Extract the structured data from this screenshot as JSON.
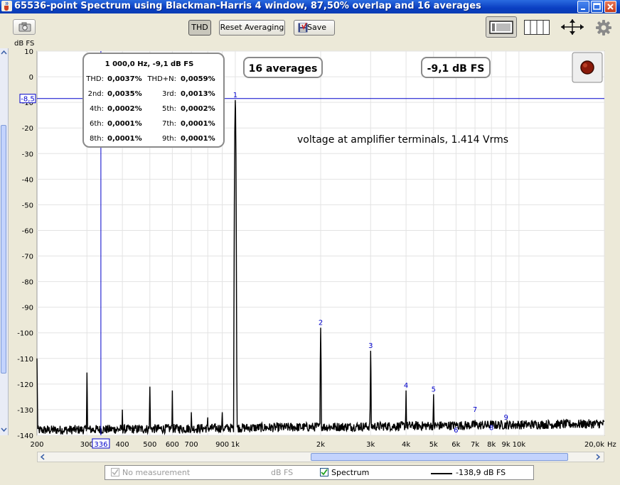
{
  "window": {
    "title": "65536-point Spectrum using Blackman-Harris 4 window, 87,50% overlap and 16 averages"
  },
  "toolbar": {
    "thd_label": "THD",
    "reset_label": "Reset Averaging",
    "save_label": "Save"
  },
  "plot": {
    "y_unit": "dB FS",
    "x_unit": "Hz",
    "background": "#ffffff",
    "grid_color": "#e3e3e3",
    "trace_color": "#000000",
    "cursor_color": "#0000cc",
    "cursor_x_label": "336",
    "cursor_y_label": "-8,5",
    "averages_label": "16 averages",
    "level_label": "-9,1 dB FS",
    "annotation": "voltage at amplifier terminals, 1.414 Vrms",
    "thd_box": {
      "header": "1 000,0 Hz, -9,1 dB FS",
      "rows": [
        {
          "l1": "THD:",
          "v1": "0,0037%",
          "l2": "THD+N:",
          "v2": "0,0059%"
        },
        {
          "l1": "2nd:",
          "v1": "0,0035%",
          "l2": "3rd:",
          "v2": "0,0013%"
        },
        {
          "l1": "4th:",
          "v1": "0,0002%",
          "l2": "5th:",
          "v2": "0,0002%"
        },
        {
          "l1": "6th:",
          "v1": "0,0001%",
          "l2": "7th:",
          "v2": "0,0001%"
        },
        {
          "l1": "8th:",
          "v1": "0,0001%",
          "l2": "9th:",
          "v2": "0,0001%"
        }
      ]
    }
  },
  "chart_data": {
    "type": "line",
    "x_scale": "log",
    "xlim": [
      200,
      20000
    ],
    "ylim": [
      -140,
      10
    ],
    "x_ticks": [
      {
        "v": 200,
        "label": "200"
      },
      {
        "v": 300,
        "label": "300"
      },
      {
        "v": 400,
        "label": "400"
      },
      {
        "v": 500,
        "label": "500"
      },
      {
        "v": 600,
        "label": "600"
      },
      {
        "v": 700,
        "label": "700"
      },
      {
        "v": 900,
        "label": "900"
      },
      {
        "v": 1000,
        "label": "1k"
      },
      {
        "v": 2000,
        "label": "2k"
      },
      {
        "v": 3000,
        "label": "3k"
      },
      {
        "v": 4000,
        "label": "4k"
      },
      {
        "v": 5000,
        "label": "5k"
      },
      {
        "v": 6000,
        "label": "6k"
      },
      {
        "v": 7000,
        "label": "7k"
      },
      {
        "v": 8000,
        "label": "8k"
      },
      {
        "v": 9000,
        "label": "9k"
      },
      {
        "v": 10000,
        "label": "10k"
      },
      {
        "v": 20000,
        "label": "20,0k"
      }
    ],
    "y_ticks": [
      10,
      0,
      -10,
      -20,
      -30,
      -40,
      -50,
      -60,
      -70,
      -80,
      -90,
      -100,
      -110,
      -120,
      -130,
      -140
    ],
    "series": [
      {
        "name": "Spectrum",
        "noise_floor": -138,
        "peaks": [
          {
            "x": 200,
            "y": -110
          },
          {
            "x": 300,
            "y": -115.5
          },
          {
            "x": 400,
            "y": -130
          },
          {
            "x": 500,
            "y": -121
          },
          {
            "x": 600,
            "y": -122.5
          },
          {
            "x": 700,
            "y": -131
          },
          {
            "x": 800,
            "y": -133
          },
          {
            "x": 900,
            "y": -131
          },
          {
            "x": 1000,
            "y": -9.1
          },
          {
            "x": 2000,
            "y": -98
          },
          {
            "x": 3000,
            "y": -107
          },
          {
            "x": 4000,
            "y": -122.5
          },
          {
            "x": 5000,
            "y": -124
          },
          {
            "x": 6000,
            "y": -136
          },
          {
            "x": 7000,
            "y": -134
          },
          {
            "x": 8000,
            "y": -136
          },
          {
            "x": 9000,
            "y": -135
          }
        ]
      }
    ],
    "harmonic_markers": [
      {
        "n": "1",
        "x": 1000,
        "y": -9.1
      },
      {
        "n": "2",
        "x": 2000,
        "y": -98
      },
      {
        "n": "3",
        "x": 3000,
        "y": -107
      },
      {
        "n": "4",
        "x": 4000,
        "y": -122.5
      },
      {
        "n": "5",
        "x": 5000,
        "y": -124
      },
      {
        "n": "6",
        "x": 6000,
        "y": -140
      },
      {
        "n": "7",
        "x": 7000,
        "y": -132
      },
      {
        "n": "8",
        "x": 8000,
        "y": -139
      },
      {
        "n": "9",
        "x": 9000,
        "y": -135
      }
    ],
    "cursor": {
      "x": 336,
      "y": -8.5
    }
  },
  "legend": {
    "item1_label": "No measurement",
    "item1_unit": "dB FS",
    "item2_label": "Spectrum",
    "item2_value": "-138,9 dB FS"
  },
  "icons": {
    "app": "java-cup-icon",
    "camera": "camera-icon",
    "save": "floppy-disk-icon",
    "layout1": "layout-full-icon",
    "layout2": "layout-columns-icon",
    "fit": "fit-arrows-icon",
    "settings": "gear-icon",
    "record": "record-icon"
  }
}
